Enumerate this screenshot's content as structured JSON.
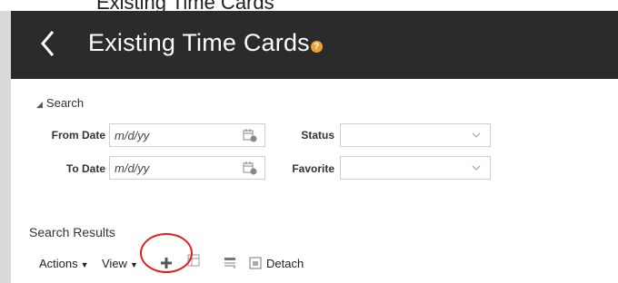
{
  "page": {
    "cut_title": "Existing Time Cards"
  },
  "header": {
    "title": "Existing Time Cards",
    "help_glyph": "?",
    "back_icon": "chevron-left-icon"
  },
  "search": {
    "toggle_label": "Search",
    "from_date": {
      "label": "From Date",
      "placeholder": "m/d/yy"
    },
    "to_date": {
      "label": "To Date",
      "placeholder": "m/d/yy"
    },
    "status": {
      "label": "Status",
      "value": ""
    },
    "favorite": {
      "label": "Favorite",
      "value": ""
    }
  },
  "results": {
    "title": "Search Results",
    "toolbar": {
      "actions_label": "Actions",
      "view_label": "View",
      "detach_label": "Detach",
      "icons": [
        "plus-icon",
        "freeze-icon",
        "wrap-icon",
        "detach-icon"
      ]
    }
  },
  "annotation": {
    "color": "#e02020",
    "target": "add-button"
  },
  "colors": {
    "header_bg": "#2b2b2b",
    "help_badge": "#f0a030"
  }
}
